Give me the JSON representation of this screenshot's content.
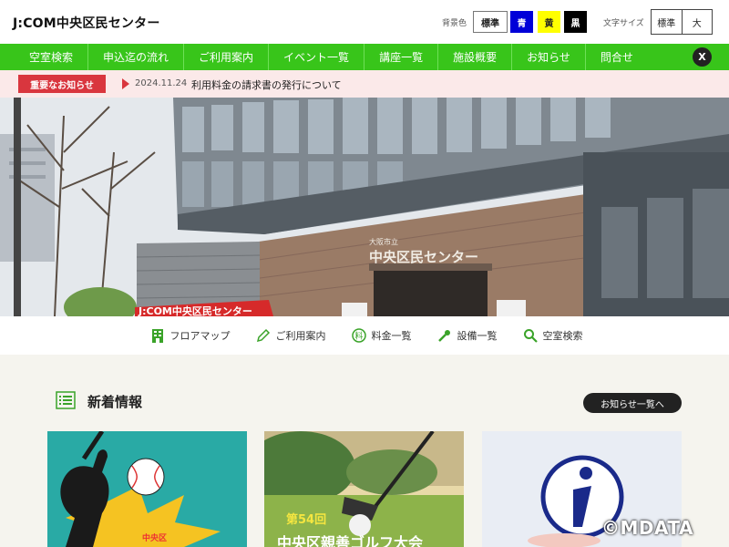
{
  "header": {
    "site_title": "J:COM中央区民センター",
    "bg_color_label": "背景色",
    "bg_options": [
      "標準",
      "青",
      "黄",
      "黒"
    ],
    "font_size_label": "文字サイズ",
    "font_options": [
      "標準",
      "大"
    ]
  },
  "nav": {
    "items": [
      "空室検索",
      "申込迄の流れ",
      "ご利用案内",
      "イベント一覧",
      "講座一覧",
      "施設概要",
      "お知らせ",
      "問合せ"
    ],
    "social": "X"
  },
  "notice": {
    "badge": "重要なお知らせ",
    "date": "2024.11.24",
    "text": "利用料金の請求書の発行について"
  },
  "hero": {
    "sign_top": "大阪市立",
    "sign_main": "中央区民センター",
    "banner": "J:COM中央区民センター"
  },
  "quick_links": [
    {
      "label": "フロアマップ",
      "icon": "building-icon"
    },
    {
      "label": "ご利用案内",
      "icon": "pencil-icon"
    },
    {
      "label": "料金一覧",
      "icon": "yen-icon"
    },
    {
      "label": "設備一覧",
      "icon": "tool-icon"
    },
    {
      "label": "空室検索",
      "icon": "search-icon"
    }
  ],
  "news": {
    "title": "新着情報",
    "more": "お知らせ一覧へ",
    "cards": [
      {
        "overlay": "中央区"
      },
      {
        "overlay_sub": "第54回",
        "overlay_main": "中央区親善ゴルフ大会"
      },
      {
        "icon": "info-icon"
      }
    ]
  },
  "watermark": "©MDATA",
  "colors": {
    "nav_green": "#38c51a",
    "notice_red": "#d9363e",
    "notice_bg": "#fbe9e9"
  }
}
